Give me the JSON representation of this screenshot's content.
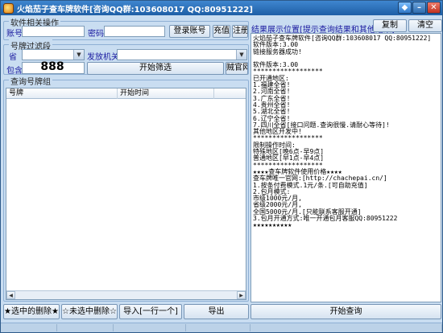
{
  "window": {
    "title": "火焰茄子查车牌软件[咨询QQ群:103608017 QQ:80951222]"
  },
  "account": {
    "group_label": "软件相关操作",
    "account_label": "账号",
    "account_value": "",
    "password_label": "密码",
    "password_value": "",
    "login_button": "登录账号",
    "recharge_button": "充值",
    "register_button": "注册"
  },
  "filter": {
    "group_label": "号牌过滤段",
    "province_label": "省",
    "province_value": "",
    "issuer_label": "发放机关",
    "issuer_value": "",
    "include_label": "包含",
    "include_count": "888",
    "start_filter_button": "开始筛选",
    "website_button": "贼官网"
  },
  "plates": {
    "group_label": "查询号牌组",
    "columns": [
      "号牌",
      "开始时间"
    ],
    "rows": []
  },
  "actions": {
    "delete_selected": "★选中的删除★",
    "delete_unselected": "☆未选中删除☆",
    "import": "导入[一行一个]",
    "export": "导出"
  },
  "result": {
    "label": "结果展示位置[提示查询结果和其他结果]",
    "copy_button": "复制",
    "clear_button": "清空",
    "lines": [
      "火焰茄子查车牌软件[咨询QQ群:103608017 QQ:80951222]",
      "软件版本:3.00",
      "链接服务器成功!",
      "",
      "软件版本:3.00",
      "******************",
      "已开通地区:",
      "1.福建全省!",
      "2.河南全省!",
      "3.广东全省!",
      "4.贵州全省!",
      "5.湖北全省!",
      "6.辽宁全省!",
      "7.四川全省[接口问题.查询很慢.请耐心等待]!",
      "其他地区开发中!",
      "******************",
      "限制操作时间:",
      "特殊地区[晚6点-早9点]",
      "普通地区[早1点-早4点]",
      "******************",
      "★★★★查车牌软件使用价格★★★★",
      "查车牌唯一官网:[http://chachepai.cn/]",
      "1.按条付费模式.1元/条.[可自助充值]",
      "2.包月模式:",
      "市级1000元/月,",
      "省级2000元/月,",
      "全国5000元/月.[只能联系客服开通]",
      "3.包月开通方式:唯一开通包月客服QQ:80951222",
      "★★★★★★★★★★"
    ]
  },
  "query": {
    "start_button": "开始查询"
  },
  "colors": {
    "window_bg": "#c9ddf1",
    "title_bar": "#1e5fa6",
    "label_blue": "#1a1aa0"
  }
}
